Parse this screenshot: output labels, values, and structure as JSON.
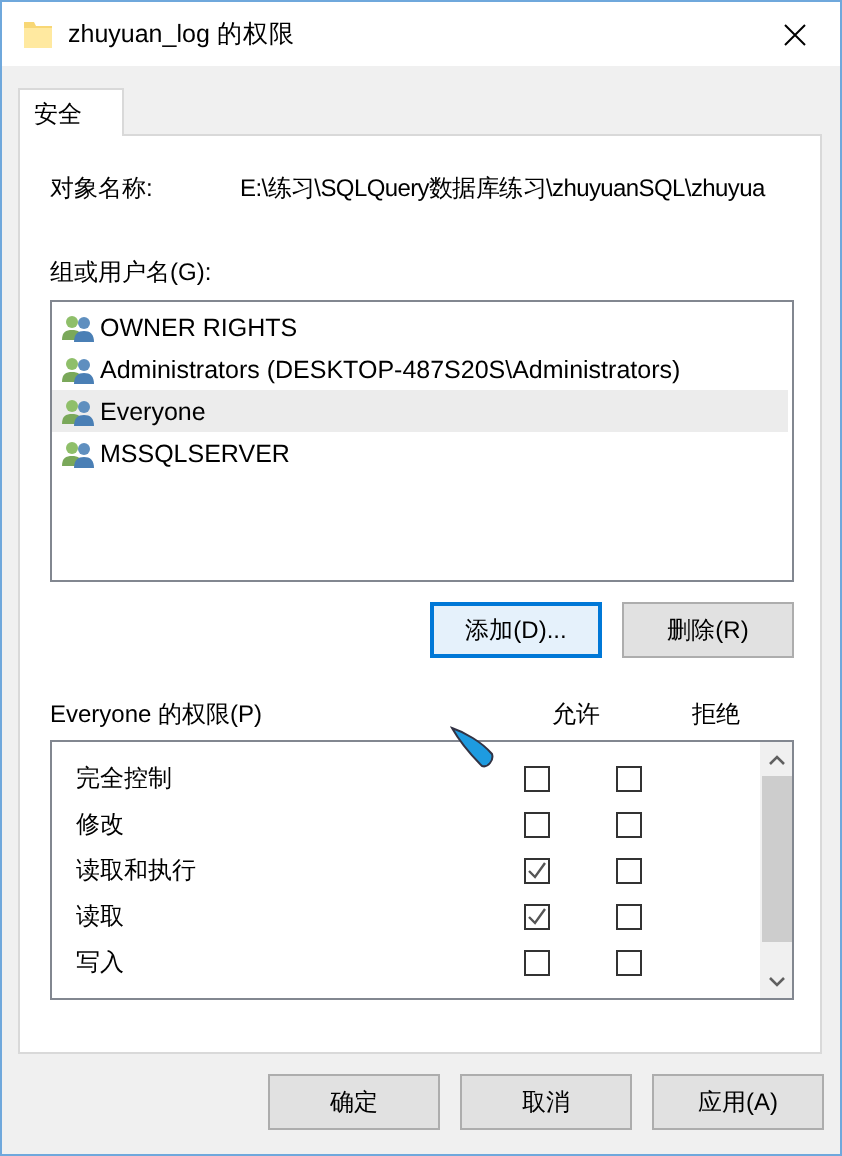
{
  "window": {
    "title": "zhuyuan_log 的权限"
  },
  "tabs": [
    {
      "label": "安全",
      "selected": true
    }
  ],
  "object_name": {
    "label": "对象名称:",
    "value": "E:\\练习\\SQLQuery数据库练习\\zhuyuanSQL\\zhuyua"
  },
  "users": {
    "label": "组或用户名(G):",
    "items": [
      {
        "name": "OWNER RIGHTS",
        "selected": false
      },
      {
        "name": "Administrators (DESKTOP-487S20S\\Administrators)",
        "selected": false
      },
      {
        "name": "Everyone",
        "selected": true
      },
      {
        "name": "MSSQLSERVER",
        "selected": false
      }
    ],
    "buttons": [
      {
        "label": "添加(D)...",
        "default": true
      },
      {
        "label": "删除(R)",
        "default": false
      }
    ]
  },
  "permissions": {
    "label": "Everyone 的权限(P)",
    "allow_heading": "允许",
    "deny_heading": "拒绝",
    "rows": [
      {
        "name": "完全控制",
        "allow": false,
        "deny": false
      },
      {
        "name": "修改",
        "allow": false,
        "deny": false
      },
      {
        "name": "读取和执行",
        "allow": true,
        "deny": false
      },
      {
        "name": "读取",
        "allow": true,
        "deny": false
      },
      {
        "name": "写入",
        "allow": false,
        "deny": false
      }
    ]
  },
  "buttons": [
    {
      "label": "确定"
    },
    {
      "label": "取消"
    },
    {
      "label": "应用(A)"
    }
  ]
}
